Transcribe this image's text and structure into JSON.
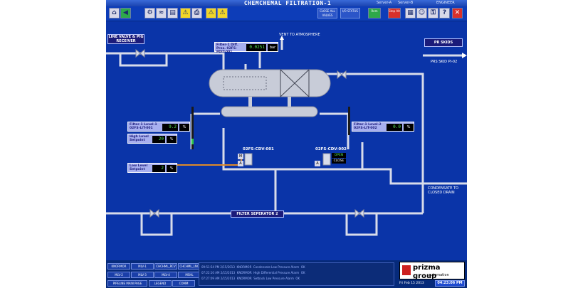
{
  "window": {
    "title": "CHEMCHEMAL FILTRATION-1",
    "server_a": "Server-A",
    "server_b": "Server-B",
    "user": "ENGINEER"
  },
  "toolbar": {
    "close_all_values": "CLOSE ALL VALVES",
    "io_status": "I/O STATUS",
    "status_btn": "Rem",
    "stop_btn": "Stop Alt"
  },
  "diagram": {
    "line_valve_label": "LINE VALVE & PIG RECEIVER",
    "pr_skids_label": "PR SKIDS",
    "vent_label": "VENT TO ATMOSPHERE",
    "prs_skid_label": "PRS SKID PI-02",
    "condensate_label": "CONDENSATE TO CLOSED DRAIN",
    "filter_label": "FILTER SEPERATOR 2",
    "diff_pres": {
      "label": "Filter-1 Diff. Pres. 02FS-PDIT-001",
      "value": "0.0251",
      "unit": "bar"
    },
    "level1": {
      "label": "Filter-1 Level-1 02FS-LIT-001",
      "value": "9.2",
      "unit": "%"
    },
    "level2": {
      "label": "Filter-1 Level-2 02FS-LIT-002",
      "value": "0.0",
      "unit": "%"
    },
    "high_level": {
      "label": "High Level Setpoint",
      "value": "20",
      "unit": "%"
    },
    "low_level": {
      "label": "Low Level Setpoint",
      "value": "2",
      "unit": "%"
    },
    "valve1": {
      "tag": "02FS-CDV-001",
      "mode": "M",
      "auto": "A"
    },
    "valve2": {
      "tag": "02FS-CDV-002",
      "open_label": "OPEN",
      "close_label": "CLOSE",
      "auto": "A"
    }
  },
  "nav": {
    "buttons": [
      "KNORMOR",
      "MLV-1",
      "CHCHML_RCV",
      "CHCHML_LNC",
      "MLV-2",
      "MLV-3",
      "MLV-4",
      "MSHL",
      "PIPELINE MAIN PAGE",
      "LEGEND",
      "COMM"
    ]
  },
  "alarms": [
    {
      "time": "09:51:54 PM 2/15/2013",
      "src": "KNORMOR",
      "msg": "Condensate Low Pressure Alarm",
      "state": "OK"
    },
    {
      "time": "07:22:10 AM 2/15/2013",
      "src": "KNORMOR",
      "msg": "High Differential Pressure Alarm",
      "state": "OK"
    },
    {
      "time": "07:27:09 AM 2/15/2013",
      "src": "KNORMOR",
      "msg": "Setback Low Pressure Alarm",
      "state": "OK"
    }
  ],
  "logo": {
    "brand": "prizma group",
    "sub": "automation"
  },
  "status": {
    "date": "Fri Feb 15 2013",
    "time": "04:23:06 PM"
  },
  "colors": {
    "background": "#0a34a8",
    "pipe": "#d8dcea",
    "value_text": "#58e858"
  }
}
